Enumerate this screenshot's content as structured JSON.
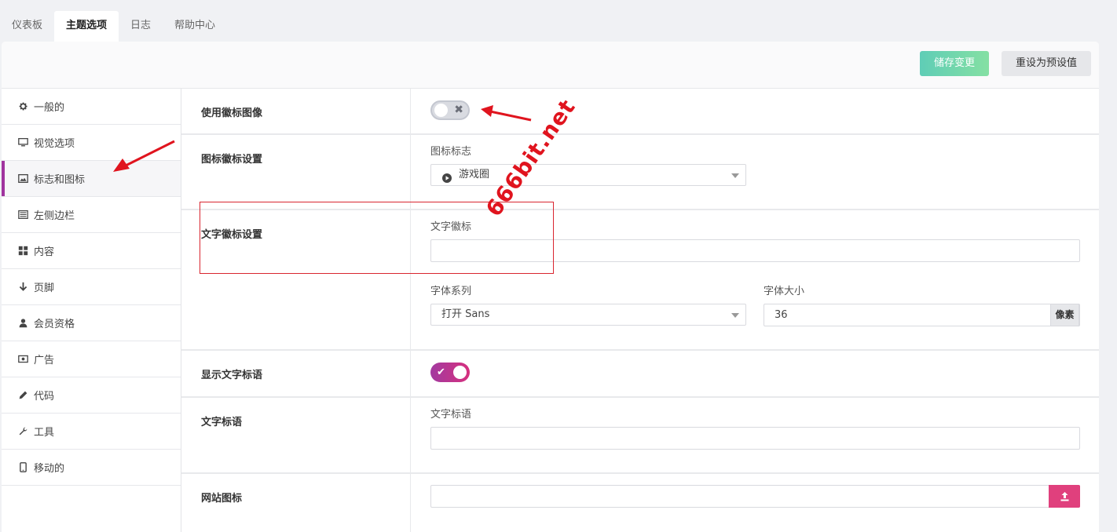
{
  "top_tabs": [
    {
      "label": "仪表板",
      "active": false
    },
    {
      "label": "主题选项",
      "active": true
    },
    {
      "label": "日志",
      "active": false
    },
    {
      "label": "帮助中心",
      "active": false
    }
  ],
  "header": {
    "save_label": "储存变更",
    "reset_label": "重设为预设值"
  },
  "sidebar": {
    "items": [
      {
        "label": "一般的",
        "icon": "gear-icon"
      },
      {
        "label": "视觉选项",
        "icon": "monitor-icon"
      },
      {
        "label": "标志和图标",
        "icon": "image-icon",
        "active": true
      },
      {
        "label": "左侧边栏",
        "icon": "list-icon"
      },
      {
        "label": "内容",
        "icon": "grid-icon"
      },
      {
        "label": "页脚",
        "icon": "arrow-down-icon"
      },
      {
        "label": "会员资格",
        "icon": "user-icon"
      },
      {
        "label": "广告",
        "icon": "money-icon"
      },
      {
        "label": "代码",
        "icon": "pencil-icon"
      },
      {
        "label": "工具",
        "icon": "wrench-icon"
      },
      {
        "label": "移动的",
        "icon": "mobile-icon"
      }
    ]
  },
  "settings": {
    "use_logo_image": {
      "label": "使用徽标图像",
      "enabled": false,
      "mark": "✖"
    },
    "icon_logo": {
      "label": "图标徽标设置",
      "field_label": "图标标志",
      "selected": "游戏圈"
    },
    "text_logo": {
      "label": "文字徽标设置",
      "field_label": "文字徽标",
      "value": "",
      "font_family_label": "字体系列",
      "font_family": "打开 Sans",
      "font_size_label": "字体大小",
      "font_size": "36",
      "font_size_unit": "像素"
    },
    "show_tagline": {
      "label": "显示文字标语",
      "enabled": true,
      "mark": "✔"
    },
    "tagline": {
      "label": "文字标语",
      "field_label": "文字标语",
      "value": ""
    },
    "favicon": {
      "label": "网站图标",
      "value": ""
    }
  },
  "annotation": {
    "watermark": "666bit.net",
    "color": "#e0141e"
  },
  "colors": {
    "accent": "#a0339e",
    "save_gradient_start": "#5fcdb6",
    "upload": "#e0407d"
  }
}
